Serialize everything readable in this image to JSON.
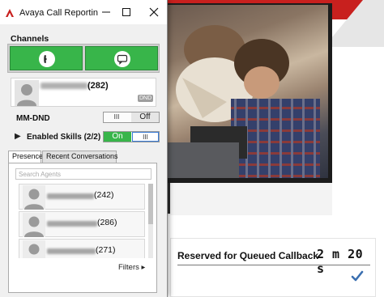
{
  "window": {
    "title": "Avaya Call Reportin",
    "controls": {
      "minimize_icon": "minimize-icon",
      "maximize_icon": "maximize-icon",
      "close_icon": "close-icon"
    }
  },
  "channels": {
    "label": "Channels",
    "voice_icon": "phone-icon",
    "chat_icon": "chat-bubble-icon",
    "active_color": "#38b54a"
  },
  "agent": {
    "extension": "(282)",
    "status_badge": "DND"
  },
  "mm_dnd": {
    "label": "MM-DND",
    "grip": "III",
    "state": "Off"
  },
  "skills": {
    "label": "Enabled Skills (2/2)",
    "state": "On",
    "grip": "III"
  },
  "tabs": [
    {
      "label": "Presence",
      "active": true
    },
    {
      "label": "Recent Conversations",
      "active": false
    }
  ],
  "presence": {
    "search_placeholder": "Search Agents",
    "agents": [
      {
        "ext": "(242)"
      },
      {
        "ext": "(286)"
      },
      {
        "ext": "(271)"
      }
    ],
    "filters_label": "Filters ▸"
  },
  "callback": {
    "label": "Reserved for Queued Callback",
    "timer": "2 m 20 s",
    "confirm_icon": "checkmark-icon"
  },
  "colors": {
    "brand_red": "#c8201e",
    "accent_green": "#38b54a"
  }
}
